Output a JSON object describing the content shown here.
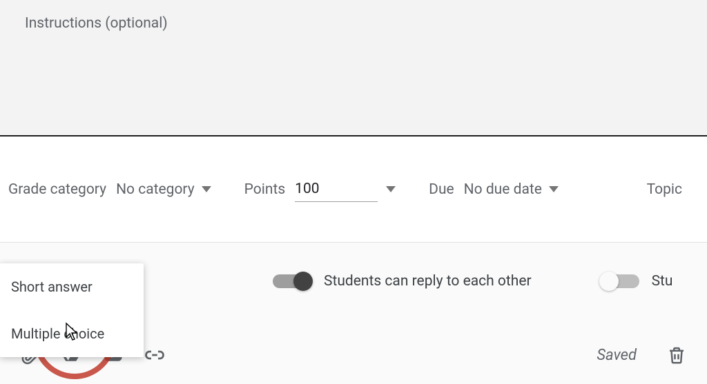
{
  "instructions": {
    "placeholder": "Instructions (optional)",
    "value": ""
  },
  "meta": {
    "gradeCategory": {
      "label": "Grade category",
      "value": "No category"
    },
    "points": {
      "label": "Points",
      "value": "100"
    },
    "due": {
      "label": "Due",
      "value": "No due date"
    },
    "topic": {
      "label": "Topic"
    }
  },
  "toggles": {
    "studentsCanReply": {
      "label": "Students can reply to each other",
      "on": true
    },
    "second": {
      "label": "Stu",
      "on": false
    }
  },
  "popup": {
    "items": [
      {
        "label": "Short answer"
      },
      {
        "label": "Multiple choice"
      }
    ]
  },
  "status": {
    "saved": "Saved"
  },
  "icons": {
    "attachment": "attachment-icon",
    "drive": "drive-icon",
    "youtube": "youtube-icon",
    "link": "link-icon",
    "delete": "delete-icon"
  }
}
